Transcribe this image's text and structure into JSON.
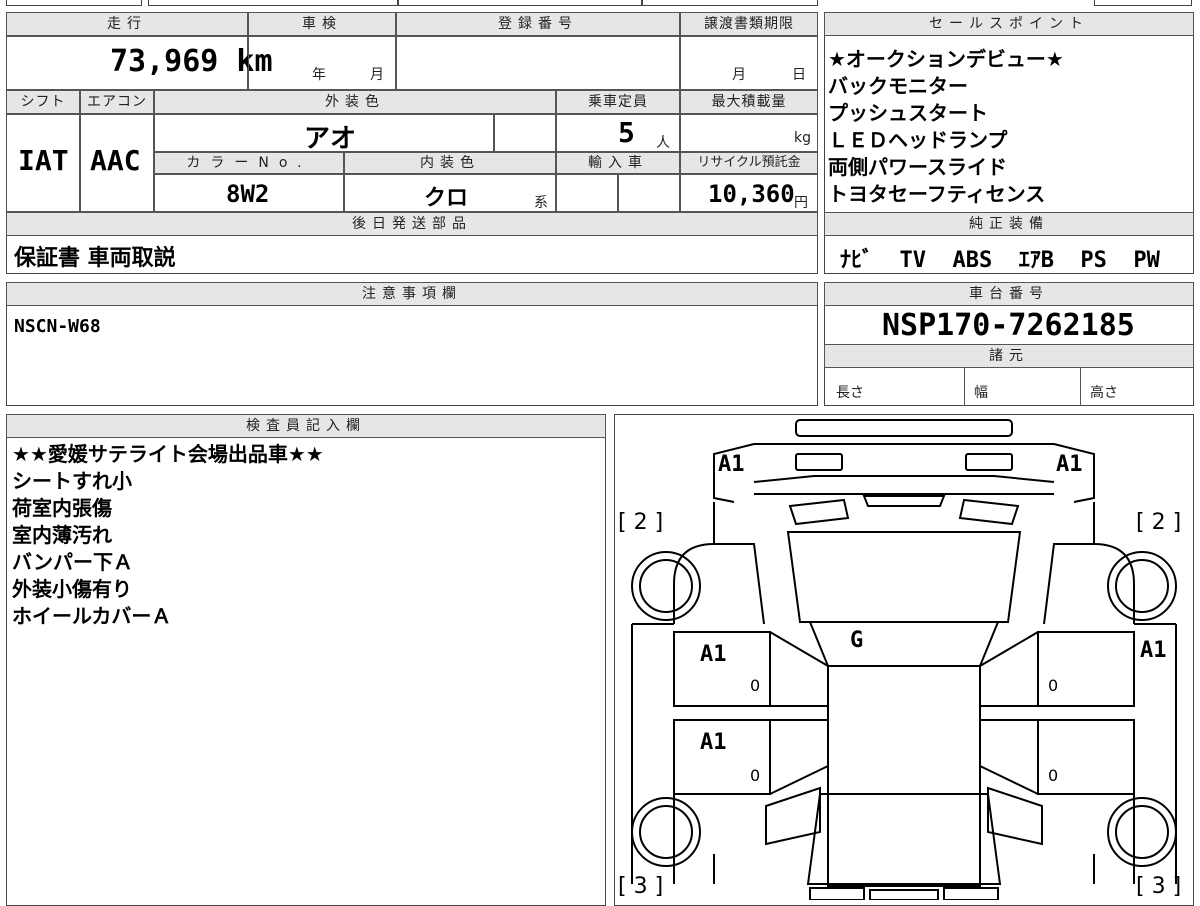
{
  "top": {
    "mileage_label": "走行",
    "mileage_value": "73,969 km",
    "inspection_label": "車検",
    "inspection_year_unit": "年",
    "inspection_month_unit": "月",
    "registration_label": "登録番号",
    "transfer_label": "譲渡書類期限",
    "transfer_month_unit": "月",
    "transfer_day_unit": "日",
    "shift_label": "シフト",
    "shift_value": "IAT",
    "aircon_label": "エアコン",
    "aircon_value": "AAC",
    "exterior_label": "外装色",
    "exterior_value": "アオ",
    "capacity_label": "乗車定員",
    "capacity_value": "5",
    "capacity_unit": "人",
    "maxload_label": "最大積載量",
    "maxload_unit": "kg",
    "colorno_label": "カラーNo.",
    "colorno_value": "8W2",
    "interior_label": "内装色",
    "interior_value": "クロ",
    "interior_suffix": "系",
    "import_label": "輸入車",
    "recycle_label": "リサイクル預託金",
    "recycle_value": "10,360",
    "recycle_unit": "円",
    "later_parts_label": "後日発送部品",
    "later_parts_value": "保証書 車両取説"
  },
  "sales": {
    "label": "セールスポイント",
    "items": [
      "★オークションデビュー★",
      "バックモニター",
      "プッシュスタート",
      "ＬＥＤヘッドランプ",
      "両側パワースライド",
      "トヨタセーフティセンス"
    ]
  },
  "equipment": {
    "label": "純正装備",
    "value": "ﾅﾋﾞ  TV  ABS  ｴｱB  PS  PW"
  },
  "notes": {
    "label": "注意事項欄",
    "value": "NSCN-W68"
  },
  "chassis": {
    "label": "車台番号",
    "value": "NSP170-7262185",
    "spec_label": "諸元",
    "length_label": "長さ",
    "width_label": "幅",
    "height_label": "高さ"
  },
  "inspector": {
    "label": "検査員記入欄",
    "lines": [
      "★★愛媛サテライト会場出品車★★",
      "シートすれ小",
      "荷室内張傷",
      "室内薄汚れ",
      "バンパー下Ａ",
      "外装小傷有り",
      "ホイールカバーＡ"
    ]
  },
  "diagram": {
    "mark_front_left": "A1",
    "mark_front_right": "A1",
    "mark_glass": "G",
    "mark_door_fl": "A1",
    "mark_door_rl": "A1",
    "mark_right_side": "A1",
    "tire_front_left": "[ 2 ]",
    "tire_front_right": "[ 2 ]",
    "tire_rear_left": "[ 3 ]",
    "tire_rear_right": "[ 3 ]",
    "zero_1": "0",
    "zero_2": "0",
    "zero_3": "0",
    "zero_4": "0"
  }
}
